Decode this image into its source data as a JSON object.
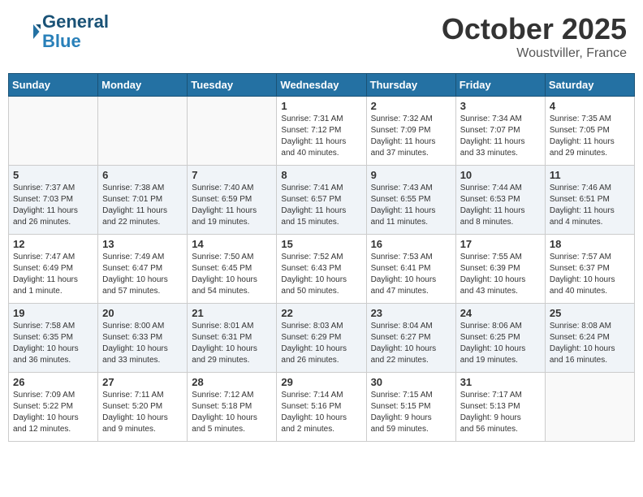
{
  "header": {
    "logo_line1": "General",
    "logo_line2": "Blue",
    "month": "October 2025",
    "location": "Woustviller, France"
  },
  "days_of_week": [
    "Sunday",
    "Monday",
    "Tuesday",
    "Wednesday",
    "Thursday",
    "Friday",
    "Saturday"
  ],
  "weeks": [
    {
      "cells": [
        {
          "day": "",
          "info": ""
        },
        {
          "day": "",
          "info": ""
        },
        {
          "day": "",
          "info": ""
        },
        {
          "day": "1",
          "info": "Sunrise: 7:31 AM\nSunset: 7:12 PM\nDaylight: 11 hours\nand 40 minutes."
        },
        {
          "day": "2",
          "info": "Sunrise: 7:32 AM\nSunset: 7:09 PM\nDaylight: 11 hours\nand 37 minutes."
        },
        {
          "day": "3",
          "info": "Sunrise: 7:34 AM\nSunset: 7:07 PM\nDaylight: 11 hours\nand 33 minutes."
        },
        {
          "day": "4",
          "info": "Sunrise: 7:35 AM\nSunset: 7:05 PM\nDaylight: 11 hours\nand 29 minutes."
        }
      ]
    },
    {
      "cells": [
        {
          "day": "5",
          "info": "Sunrise: 7:37 AM\nSunset: 7:03 PM\nDaylight: 11 hours\nand 26 minutes."
        },
        {
          "day": "6",
          "info": "Sunrise: 7:38 AM\nSunset: 7:01 PM\nDaylight: 11 hours\nand 22 minutes."
        },
        {
          "day": "7",
          "info": "Sunrise: 7:40 AM\nSunset: 6:59 PM\nDaylight: 11 hours\nand 19 minutes."
        },
        {
          "day": "8",
          "info": "Sunrise: 7:41 AM\nSunset: 6:57 PM\nDaylight: 11 hours\nand 15 minutes."
        },
        {
          "day": "9",
          "info": "Sunrise: 7:43 AM\nSunset: 6:55 PM\nDaylight: 11 hours\nand 11 minutes."
        },
        {
          "day": "10",
          "info": "Sunrise: 7:44 AM\nSunset: 6:53 PM\nDaylight: 11 hours\nand 8 minutes."
        },
        {
          "day": "11",
          "info": "Sunrise: 7:46 AM\nSunset: 6:51 PM\nDaylight: 11 hours\nand 4 minutes."
        }
      ]
    },
    {
      "cells": [
        {
          "day": "12",
          "info": "Sunrise: 7:47 AM\nSunset: 6:49 PM\nDaylight: 11 hours\nand 1 minute."
        },
        {
          "day": "13",
          "info": "Sunrise: 7:49 AM\nSunset: 6:47 PM\nDaylight: 10 hours\nand 57 minutes."
        },
        {
          "day": "14",
          "info": "Sunrise: 7:50 AM\nSunset: 6:45 PM\nDaylight: 10 hours\nand 54 minutes."
        },
        {
          "day": "15",
          "info": "Sunrise: 7:52 AM\nSunset: 6:43 PM\nDaylight: 10 hours\nand 50 minutes."
        },
        {
          "day": "16",
          "info": "Sunrise: 7:53 AM\nSunset: 6:41 PM\nDaylight: 10 hours\nand 47 minutes."
        },
        {
          "day": "17",
          "info": "Sunrise: 7:55 AM\nSunset: 6:39 PM\nDaylight: 10 hours\nand 43 minutes."
        },
        {
          "day": "18",
          "info": "Sunrise: 7:57 AM\nSunset: 6:37 PM\nDaylight: 10 hours\nand 40 minutes."
        }
      ]
    },
    {
      "cells": [
        {
          "day": "19",
          "info": "Sunrise: 7:58 AM\nSunset: 6:35 PM\nDaylight: 10 hours\nand 36 minutes."
        },
        {
          "day": "20",
          "info": "Sunrise: 8:00 AM\nSunset: 6:33 PM\nDaylight: 10 hours\nand 33 minutes."
        },
        {
          "day": "21",
          "info": "Sunrise: 8:01 AM\nSunset: 6:31 PM\nDaylight: 10 hours\nand 29 minutes."
        },
        {
          "day": "22",
          "info": "Sunrise: 8:03 AM\nSunset: 6:29 PM\nDaylight: 10 hours\nand 26 minutes."
        },
        {
          "day": "23",
          "info": "Sunrise: 8:04 AM\nSunset: 6:27 PM\nDaylight: 10 hours\nand 22 minutes."
        },
        {
          "day": "24",
          "info": "Sunrise: 8:06 AM\nSunset: 6:25 PM\nDaylight: 10 hours\nand 19 minutes."
        },
        {
          "day": "25",
          "info": "Sunrise: 8:08 AM\nSunset: 6:24 PM\nDaylight: 10 hours\nand 16 minutes."
        }
      ]
    },
    {
      "cells": [
        {
          "day": "26",
          "info": "Sunrise: 7:09 AM\nSunset: 5:22 PM\nDaylight: 10 hours\nand 12 minutes."
        },
        {
          "day": "27",
          "info": "Sunrise: 7:11 AM\nSunset: 5:20 PM\nDaylight: 10 hours\nand 9 minutes."
        },
        {
          "day": "28",
          "info": "Sunrise: 7:12 AM\nSunset: 5:18 PM\nDaylight: 10 hours\nand 5 minutes."
        },
        {
          "day": "29",
          "info": "Sunrise: 7:14 AM\nSunset: 5:16 PM\nDaylight: 10 hours\nand 2 minutes."
        },
        {
          "day": "30",
          "info": "Sunrise: 7:15 AM\nSunset: 5:15 PM\nDaylight: 9 hours\nand 59 minutes."
        },
        {
          "day": "31",
          "info": "Sunrise: 7:17 AM\nSunset: 5:13 PM\nDaylight: 9 hours\nand 56 minutes."
        },
        {
          "day": "",
          "info": ""
        }
      ]
    }
  ]
}
